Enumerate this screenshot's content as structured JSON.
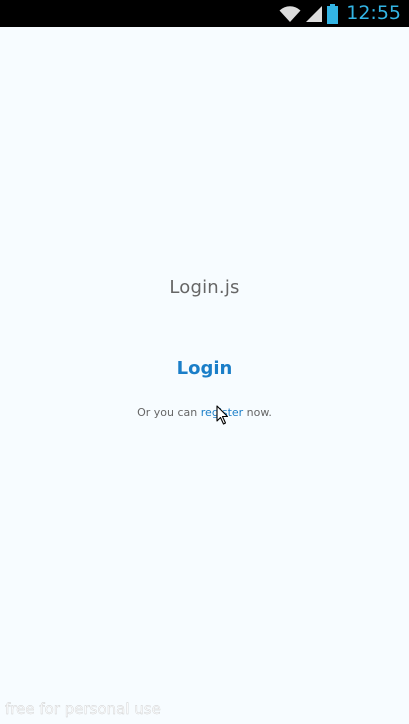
{
  "status_bar": {
    "time": "12:55",
    "icons": [
      "wifi-icon",
      "signal-icon",
      "battery-icon"
    ],
    "icon_color": "#dddddd",
    "time_color": "#33b5e5"
  },
  "screen": {
    "title": "Login.js",
    "login_label": "Login",
    "register_prefix": "Or you can ",
    "register_link": "register",
    "register_suffix": " now."
  },
  "watermark": "free for personal use",
  "colors": {
    "background": "#f7fcff",
    "link": "#1a7ec8",
    "text": "#666666"
  }
}
